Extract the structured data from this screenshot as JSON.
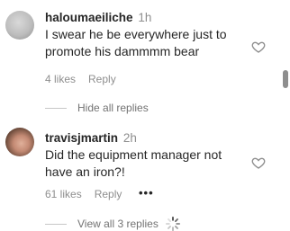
{
  "comments": [
    {
      "username": "haloumaeiliche",
      "time": "1h",
      "text": "I swear he be everywhere just to promote his dammmm bear",
      "likes": "4 likes",
      "reply_label": "Reply"
    },
    {
      "username": "travisjmartin",
      "time": "2h",
      "text": "Did the equipment manager not have an iron?!",
      "likes": "61 likes",
      "reply_label": "Reply",
      "more_label": "•••"
    }
  ],
  "replies_toggle_1": "Hide all replies",
  "replies_toggle_2": "View all 3 replies",
  "icons": {
    "like": "heart-icon",
    "loading": "spinner-icon",
    "more": "more-options-icon"
  }
}
